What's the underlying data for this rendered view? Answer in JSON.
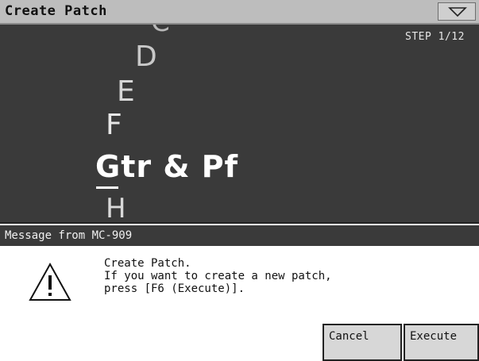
{
  "window": {
    "title": "Create Patch",
    "menu_icon": "triangle-down-icon"
  },
  "patch_list": {
    "step": "STEP 1/12",
    "items": [
      "C",
      "D",
      "E",
      "F",
      "Gtr & Pf",
      "H"
    ],
    "selected": "Gtr & Pf"
  },
  "dialog": {
    "title": "Message from MC-909",
    "icon": "warning-triangle-icon",
    "lines": [
      "Create Patch.",
      "If you want to create a new patch,",
      "press [F6 (Execute)]."
    ],
    "buttons": {
      "cancel": "Cancel",
      "execute": "Execute"
    }
  }
}
